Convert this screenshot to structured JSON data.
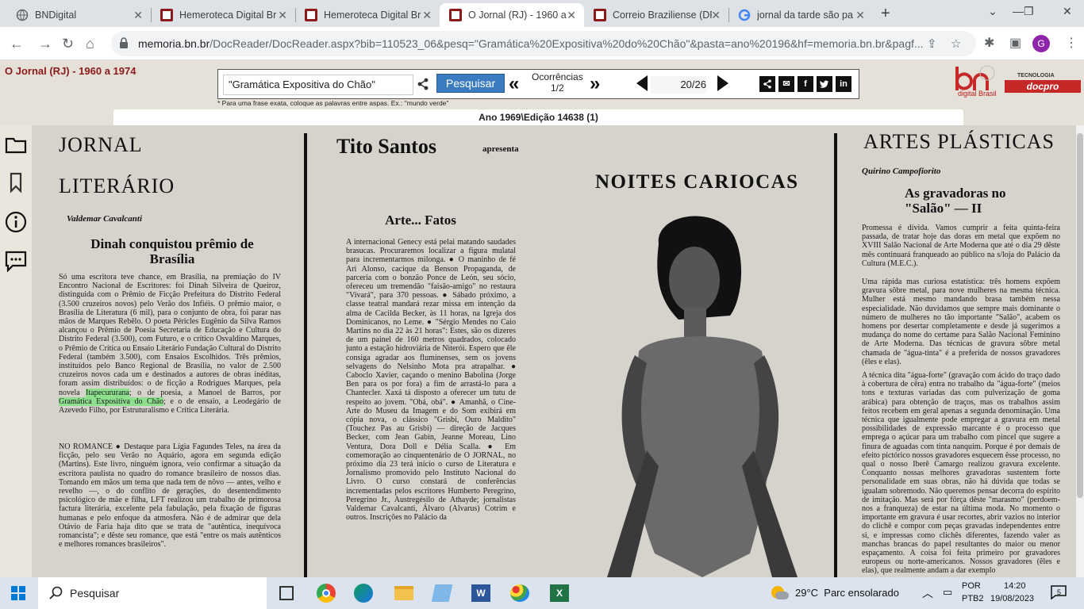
{
  "tabs": [
    {
      "title": "BNDigital"
    },
    {
      "title": "Hemeroteca Digital Br"
    },
    {
      "title": "Hemeroteca Digital Br"
    },
    {
      "title": "O Jornal (RJ) - 1960 a"
    },
    {
      "title": "Correio Braziliense (DF"
    },
    {
      "title": "jornal da tarde são pa"
    }
  ],
  "address": {
    "url_host": "memoria.bn.br",
    "url_path": "/DocReader/DocReader.aspx?bib=110523_06&pesq=\"Gramática%20Expositiva%20do%20Chão\"&pasta=ano%20196&hf=memoria.bn.br&pagf..."
  },
  "profile_initial": "G",
  "site": {
    "publication_title": "O Jornal (RJ) - 1960 a 1974",
    "search_value": "\"Gramática Expositiva do Chão\"",
    "search_button": "Pesquisar",
    "occurrences_label": "Ocorrências",
    "occurrences_value": "1/2",
    "page_current": "20",
    "page_total": "/26",
    "hint": "* Para uma frase exata, coloque as palavras entre aspas. Ex.: \"mundo verde\"",
    "edition": "Ano 1969\\Edição 14638 (1)",
    "logo_sub": "digital Brasil",
    "docpro_label": "TECNOLOGIA",
    "docpro": "docpro",
    "social": [
      "f",
      "in"
    ]
  },
  "newspaper": {
    "col1": {
      "head1": "JORNAL",
      "head2": "LITERÁRIO",
      "byline": "Valdemar Cavalcanti",
      "title": "Dinah conquistou prêmio de Brasília",
      "para1_a": "Só uma escritora teve chance, em Brasília, na premiação do IV Encontro Nacional de Escritores: foi Dinah Silveira de Queiroz, distinguida com o Prêmio de Ficção Prefeitura do Distrito Federal (3.500 cruzeiros novos) pelo Verão dos Infiéis. O prêmio maior, o Brasília de Literatura (6 mil), para o conjunto de obra, foi parar nas mãos de Marques Rebêlo. O poeta Péricles Eugênio da Silva Ramos alcançou o Prêmio de Poesia Secretaria de Educação e Cultura do Distrito Federal (3.500), com Futuro, e o crítico Osvaldino Marques, o Prêmio de Crítica ou Ensaio Literário Fundação Cultural do Distrito Federal (também 3.500), com Ensaios Escolhidos. Três prêmios, instituídos pelo Banco Regional de Brasília, no valor de 2.500 cruzeiros novos cada um e destinados a autores de obras inéditas, foram assim distribuídos: o de ficção a Rodrigues Marques, pela novela",
      "hl1": "Itapecururana",
      "para1_b": "; o de poesia, a Manoel de Barros, por",
      "hl2": "Gramática Expositiva do Chão",
      "para1_c": "; e o de ensaio, a Leodegário de Azevedo Filho, por Estruturalismo e Crítica Literária.",
      "para2": "NO ROMANCE ● Destaque para Lígia Fagundes Teles, na área da ficção, pelo seu Verão no Aquário, agora em segunda edição (Martins). Este livro, ninguém ignora, veio confirmar a situação da escritora paulista no quadro do romance brasileiro de nossos dias. Tomando em mãos um tema que nada tem de nôvo — antes, velho e revelho —, o do conflito de gerações, do desentendimento psicológico de mãe e filha, LFT realizou um trabalho de primorosa factura literária, excelente pela fabulação, pela fixação de figuras humanas e pelo enfoque da atmosfera. Não é de admirar que dela Otávio de Faria haja dito que se trata de \"autêntica, inequívoca romancista\"; e dêste seu romance, que está \"entre os mais autênticos e melhores romances brasileiros\"."
    },
    "col2": {
      "head": "Tito Santos",
      "apresenta": "apresenta",
      "noites": "NOITES CARIOCAS",
      "title": "Arte... Fatos",
      "body": "A internacional Genecy está pelai matando saudades brasucas. Procuraremos localizar a figura mulatal para incrementarmos milonga. ● O maninho de fé Ari Alonso, cacique da Benson Propaganda, de parceria com o bonzão Ponce de León, seu sócio, ofereceu um tremendão \"faisão-amigo\" no restaura \"Vivará\", para 370 pessoas. ● Sábado próximo, a classe teatral mandará rezar missa em intenção da alma de Cacilda Becker, às 11 horas, na Igreja dos Dominicanos, no Leme. ● \"Sérgio Mendes no Caio Martins no dia 22 às 21 horas\": Estes, são os dizeres de um painel de 160 metros quadrados, colocado junto a estação hidroviária de Niterói. Espero que êle consiga agradar aos fluminenses, sem os jovens selvagens do Nelsinho Mota pra atrapalhar. ● Caboclo Xavier, caçando o menino Babolina (Jorge Ben para os por fora) a fim de arrastá-lo para a Chantecler. Xaxá tá disposto a oferecer um tutu de respeito ao jovem. \"Obá, obá\". ● Amanhã, o Cine-Arte do Museu da Imagem e do Som exibirá em cópia nova, o clássico \"Grisbi, Ouro Maldito\" (Touchez Pas au Grisbi) — direção de Jacques Becker, com Jean Gabin, Jeanne Moreau, Lino Ventura, Dora Doll e Délia Scalla. ● Em comemoração ao cinquentenário de O JORNAL, no próximo dia 23 terá início o curso de Literatura e Jornalismo promovido pelo Instituto Nacional do Livro. O curso constará de conferências incrementadas pelos escritores Humberto Peregrino, Peregrino Jr., Austregésilo de Athayde; jornalistas Valdemar Cavalcanti, Álvaro (Alvarus) Cotrim e outros. Inscrições no Palácio da"
    },
    "col3": {
      "head": "ARTES PLÁSTICAS",
      "byline": "Quirino Campofiorito",
      "title": "As gravadoras no \"Salão\" — II",
      "para1": "Promessa é dívida. Vamos cumprir a feita quinta-feira passada, de tratar hoje das doras em metal que expõem no XVIII Salão Nacional de Arte Moderna que até o dia 29 dêste mês continuará franqueado ao público na s/loja do Palácio da Cultura (M.E.C.).",
      "para2": "Uma rápida mas curiosa estatística: três homens expõem gravura sôbre metal, para nove mulheres na mesma técnica. Mulher está mesmo mandando brasa também nessa especialidade. Não duvidamos que sempre mais dominante o número de mulheres no tão importante \"Salão\", acabem os homens por desertar completamente e desde já sugerimos a mudança do nome do certame para Salão Nacional Feminino de Arte Moderna. Das técnicas de gravura sôbre metal chamada de \"água-tinta\" é a preferida de nossos gravadores (êles e elas).",
      "para3": "A técnica dita \"água-forte\" (gravação com ácido do traço dado à cobertura de cêra) entra no trabalho da \"água-forte\" (meios tons e texturas variadas das com pulverização de goma arábica) para obtenção de traços, mas os trabalhos assim feitos recebem em geral apenas a segunda denominação. Uma técnica que igualmente pode empregar a gravura em metal possibilidades de expressão marcante é o processo que emprega o açúcar para um trabalho com pincel que sugere a finura de aguadas com tinta nanquim. Porque é por demais de efeito pictórico nossos gravadores esquecem êsse processo, no qual o nosso Iberê Camargo realizou gravura excelente. Conquanto nossas melhores gravadoras sustentem forte personalidade em suas obras, não há dúvida que todas se igualam sobremodo. Não queremos pensar decorra do espírito de imitação. Mas será por fôrça dêste \"marasmo\" (perdoem-nos a franqueza) de estar na última moda. No momento o importante em gravura é usar recortes, abrir vazios no interior do clichê e compor com peças gravadas independentes entre si, e impressas como clichês diferentes, fazendo valer as manchas brancas do papel resultantes do maior ou menor espaçamento. A coisa foi feita primeiro por gravadores europeus ou norte-americanos. Nossos gravadores (êles e elas), que realmente andam a dar exemplo"
    }
  },
  "taskbar": {
    "search_placeholder": "Pesquisar",
    "weather": "29°C  Parc ensolarado",
    "lang1": "POR",
    "lang2": "PTB2",
    "time": "14:20",
    "date": "19/08/2023",
    "notif_count": "5"
  }
}
